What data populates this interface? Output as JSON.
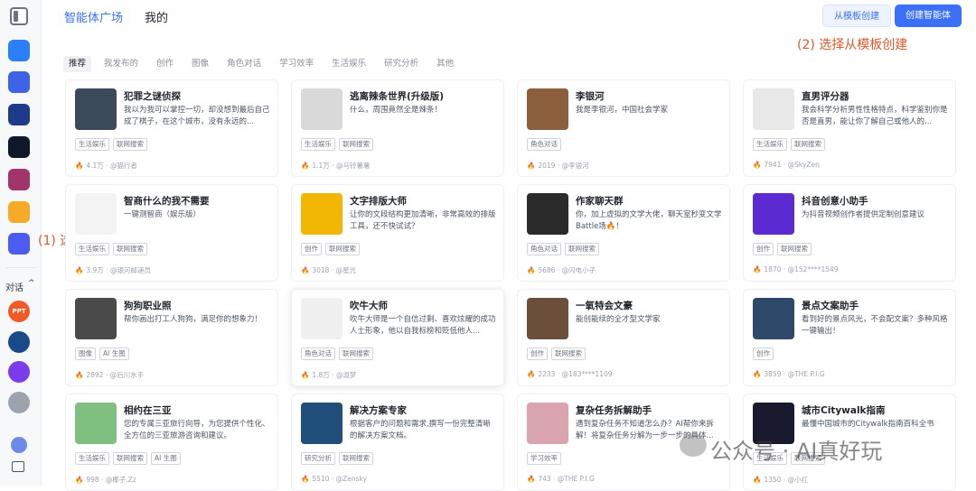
{
  "header": {
    "tabs": [
      "智能体广场",
      "我的"
    ],
    "btn_template": "从模板创建",
    "btn_create": "创建智能体"
  },
  "annotations": {
    "a1": "(2) 选择从模板创建",
    "a2": "(1) 选择此菜单"
  },
  "sidebar": {
    "section_label": "对话",
    "ppt_label": "PPT"
  },
  "filters": [
    "推荐",
    "我发布的",
    "创作",
    "图像",
    "角色对话",
    "学习效率",
    "生活娱乐",
    "研究分析",
    "其他"
  ],
  "cards": [
    {
      "title": "犯罪之谜侦探",
      "desc": "我以为我可以掌控一切，却没想到最后自己成了棋子，在这个城市，没有永远的...",
      "tags": [
        "生活娱乐",
        "联网搜索"
      ],
      "count": "4.1万",
      "author": "@猫行者"
    },
    {
      "title": "逃离辣条世界(升级版)",
      "desc": "什么，周围竟然全是辣条！",
      "tags": [
        "生活娱乐",
        "联网搜索"
      ],
      "count": "1.1万",
      "author": "@马铃薯薯"
    },
    {
      "title": "李银河",
      "desc": "我是李银河，中国社会学家",
      "tags": [
        "角色对话"
      ],
      "count": "2019",
      "author": "@李银河"
    },
    {
      "title": "直男评分器",
      "desc": "我会科学分析男性性格特点，科学鉴别你是否是直男，能让你了解自己或他人的...",
      "tags": [
        "生活娱乐",
        "联网搜索"
      ],
      "count": "7941",
      "author": "@SkyZen"
    },
    {
      "title": "智商什么的我不需要",
      "desc": "一键测智商（娱乐版）",
      "tags": [
        "生活娱乐",
        "联网搜索"
      ],
      "count": "3.9万",
      "author": "@银河邮递员"
    },
    {
      "title": "文字排版大师",
      "desc": "让你的文段结构更加清晰，非常高效的排版工具，还不快试试？",
      "tags": [
        "创作",
        "联网搜索"
      ],
      "count": "3018",
      "author": "@星光"
    },
    {
      "title": "作家聊天群",
      "desc": "你，加上虚拟的文学大佬，聊天室秒变文学Battle场🔥！",
      "tags": [
        "角色对话",
        "联网搜索"
      ],
      "count": "5686",
      "author": "@闪电小子"
    },
    {
      "title": "抖音创意小助手",
      "desc": "为抖音视频创作者提供定制创意建议",
      "tags": [
        "创作",
        "联网搜索"
      ],
      "count": "1870",
      "author": "@152****1549"
    },
    {
      "title": "狗狗职业照",
      "desc": "帮你画出打工人狗狗，满足你的想象力！",
      "tags": [
        "图像",
        "AI 生图"
      ],
      "count": "2892",
      "author": "@后川水手"
    },
    {
      "title": "吹牛大师",
      "desc": "吹牛大师是一个自信过剩、喜欢炫耀的成功人士形象，他以自我标榜和贬低他人...",
      "tags": [
        "角色对话",
        "联网搜索"
      ],
      "count": "1.8万",
      "author": "@逗梦"
    },
    {
      "title": "一氧特会文豪",
      "desc": "能创能续的全才型文学家",
      "tags": [
        "创作",
        "联网搜索"
      ],
      "count": "2233",
      "author": "@183****1109"
    },
    {
      "title": "景点文案助手",
      "desc": "看到好的景点风光，不会配文案？多种风格一键输出！",
      "tags": [
        "创作"
      ],
      "count": "3859",
      "author": "@THE P.I.G"
    },
    {
      "title": "相约在三亚",
      "desc": "您的专属三亚旅行向导，为您提供个性化、全方位的三亚旅游咨询和建议。",
      "tags": [
        "生活娱乐",
        "联网搜索",
        "AI 生图"
      ],
      "count": "998",
      "author": "@椰子.Zz"
    },
    {
      "title": "解决方案专家",
      "desc": "根据客户的问题和需求,撰写一份完整清晰的解决方案文档。",
      "tags": [
        "研究分析",
        "联网搜索"
      ],
      "count": "5510",
      "author": "@Zensky"
    },
    {
      "title": "复杂任务拆解助手",
      "desc": "遇到复杂任务不知道怎么办？AI帮你来拆解！将复杂任务分解为一步一步的具体...",
      "tags": [
        "学习效率"
      ],
      "count": "743",
      "author": "@THE P.I.G"
    },
    {
      "title": "城市Citywalk指南",
      "desc": "最懂中国城市的Citywalk指南百科全书",
      "tags": [
        "生活娱乐",
        "联网搜索"
      ],
      "count": "1350",
      "author": "@小红"
    }
  ],
  "watermark": "公众号 · AI真好玩",
  "colors": {
    "accent": "#3a6ff7",
    "annotation": "#e0582b"
  }
}
